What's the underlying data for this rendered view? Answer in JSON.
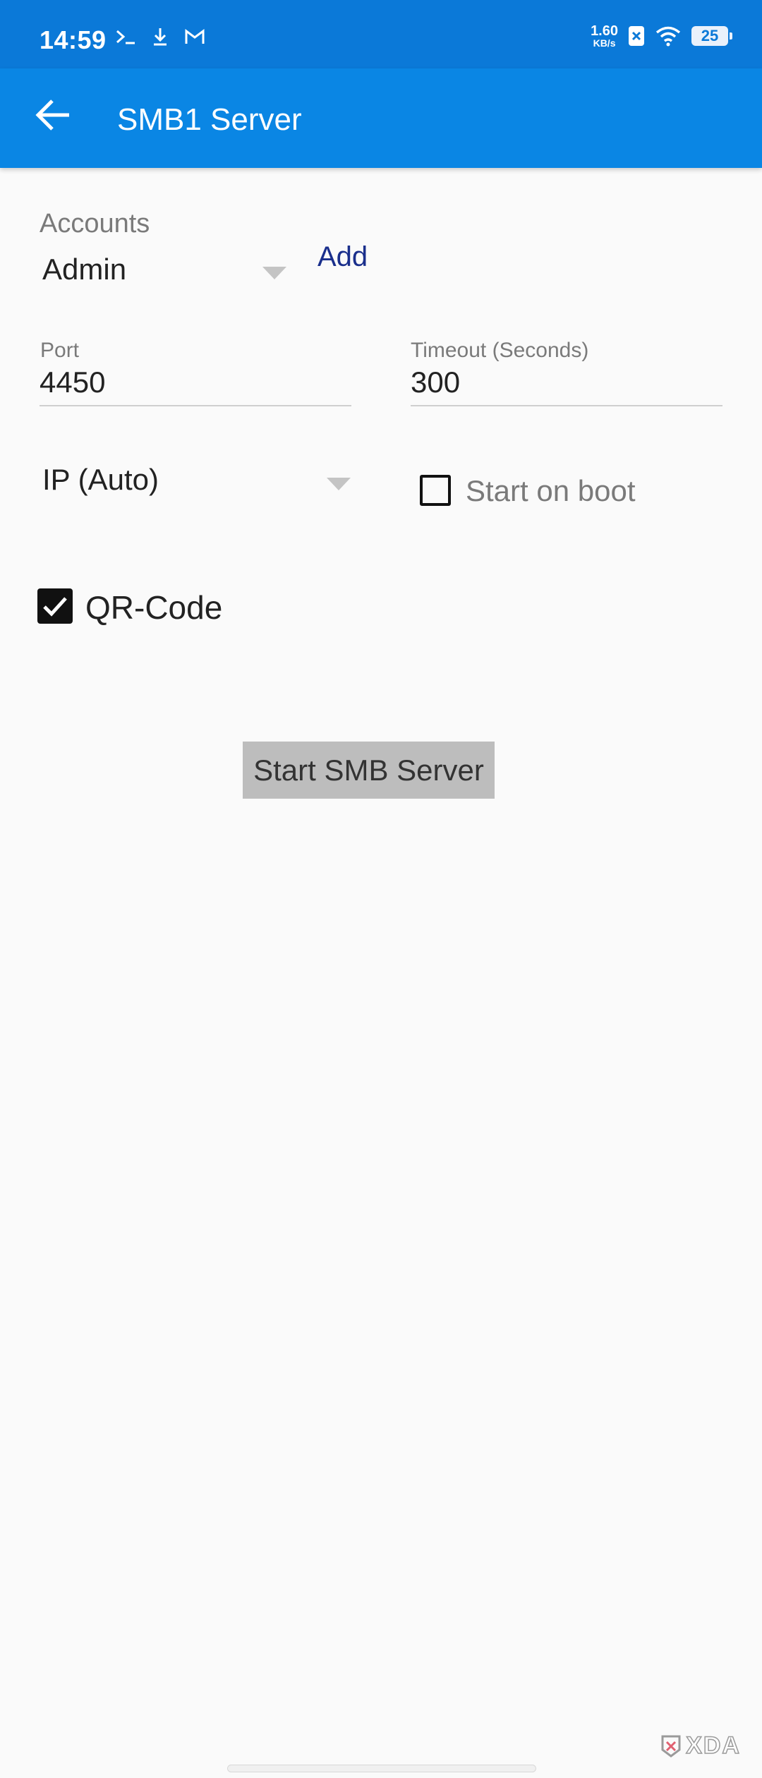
{
  "status_bar": {
    "time": "14:59",
    "net_speed_value": "1.60",
    "net_speed_unit": "KB/s",
    "battery": "25",
    "icons": [
      "terminal-icon",
      "download-icon",
      "gmail-icon",
      "no-sim-icon",
      "wifi-icon",
      "battery-icon"
    ]
  },
  "app_bar": {
    "title": "SMB1 Server",
    "back_icon": "arrow-left-icon",
    "color": "#0a86e4"
  },
  "accounts": {
    "label": "Accounts",
    "selected": "Admin",
    "add_label": "Add",
    "add_color": "#1a2f8c"
  },
  "port": {
    "label": "Port",
    "value": "4450"
  },
  "timeout": {
    "label": "Timeout (Seconds)",
    "value": "300"
  },
  "ip": {
    "selected": "IP (Auto)"
  },
  "start_on_boot": {
    "label": "Start on boot",
    "checked": false
  },
  "qr_code": {
    "label": "QR-Code",
    "checked": true
  },
  "start_button": {
    "label": "Start SMB Server"
  },
  "watermark": {
    "text": "XDA"
  }
}
